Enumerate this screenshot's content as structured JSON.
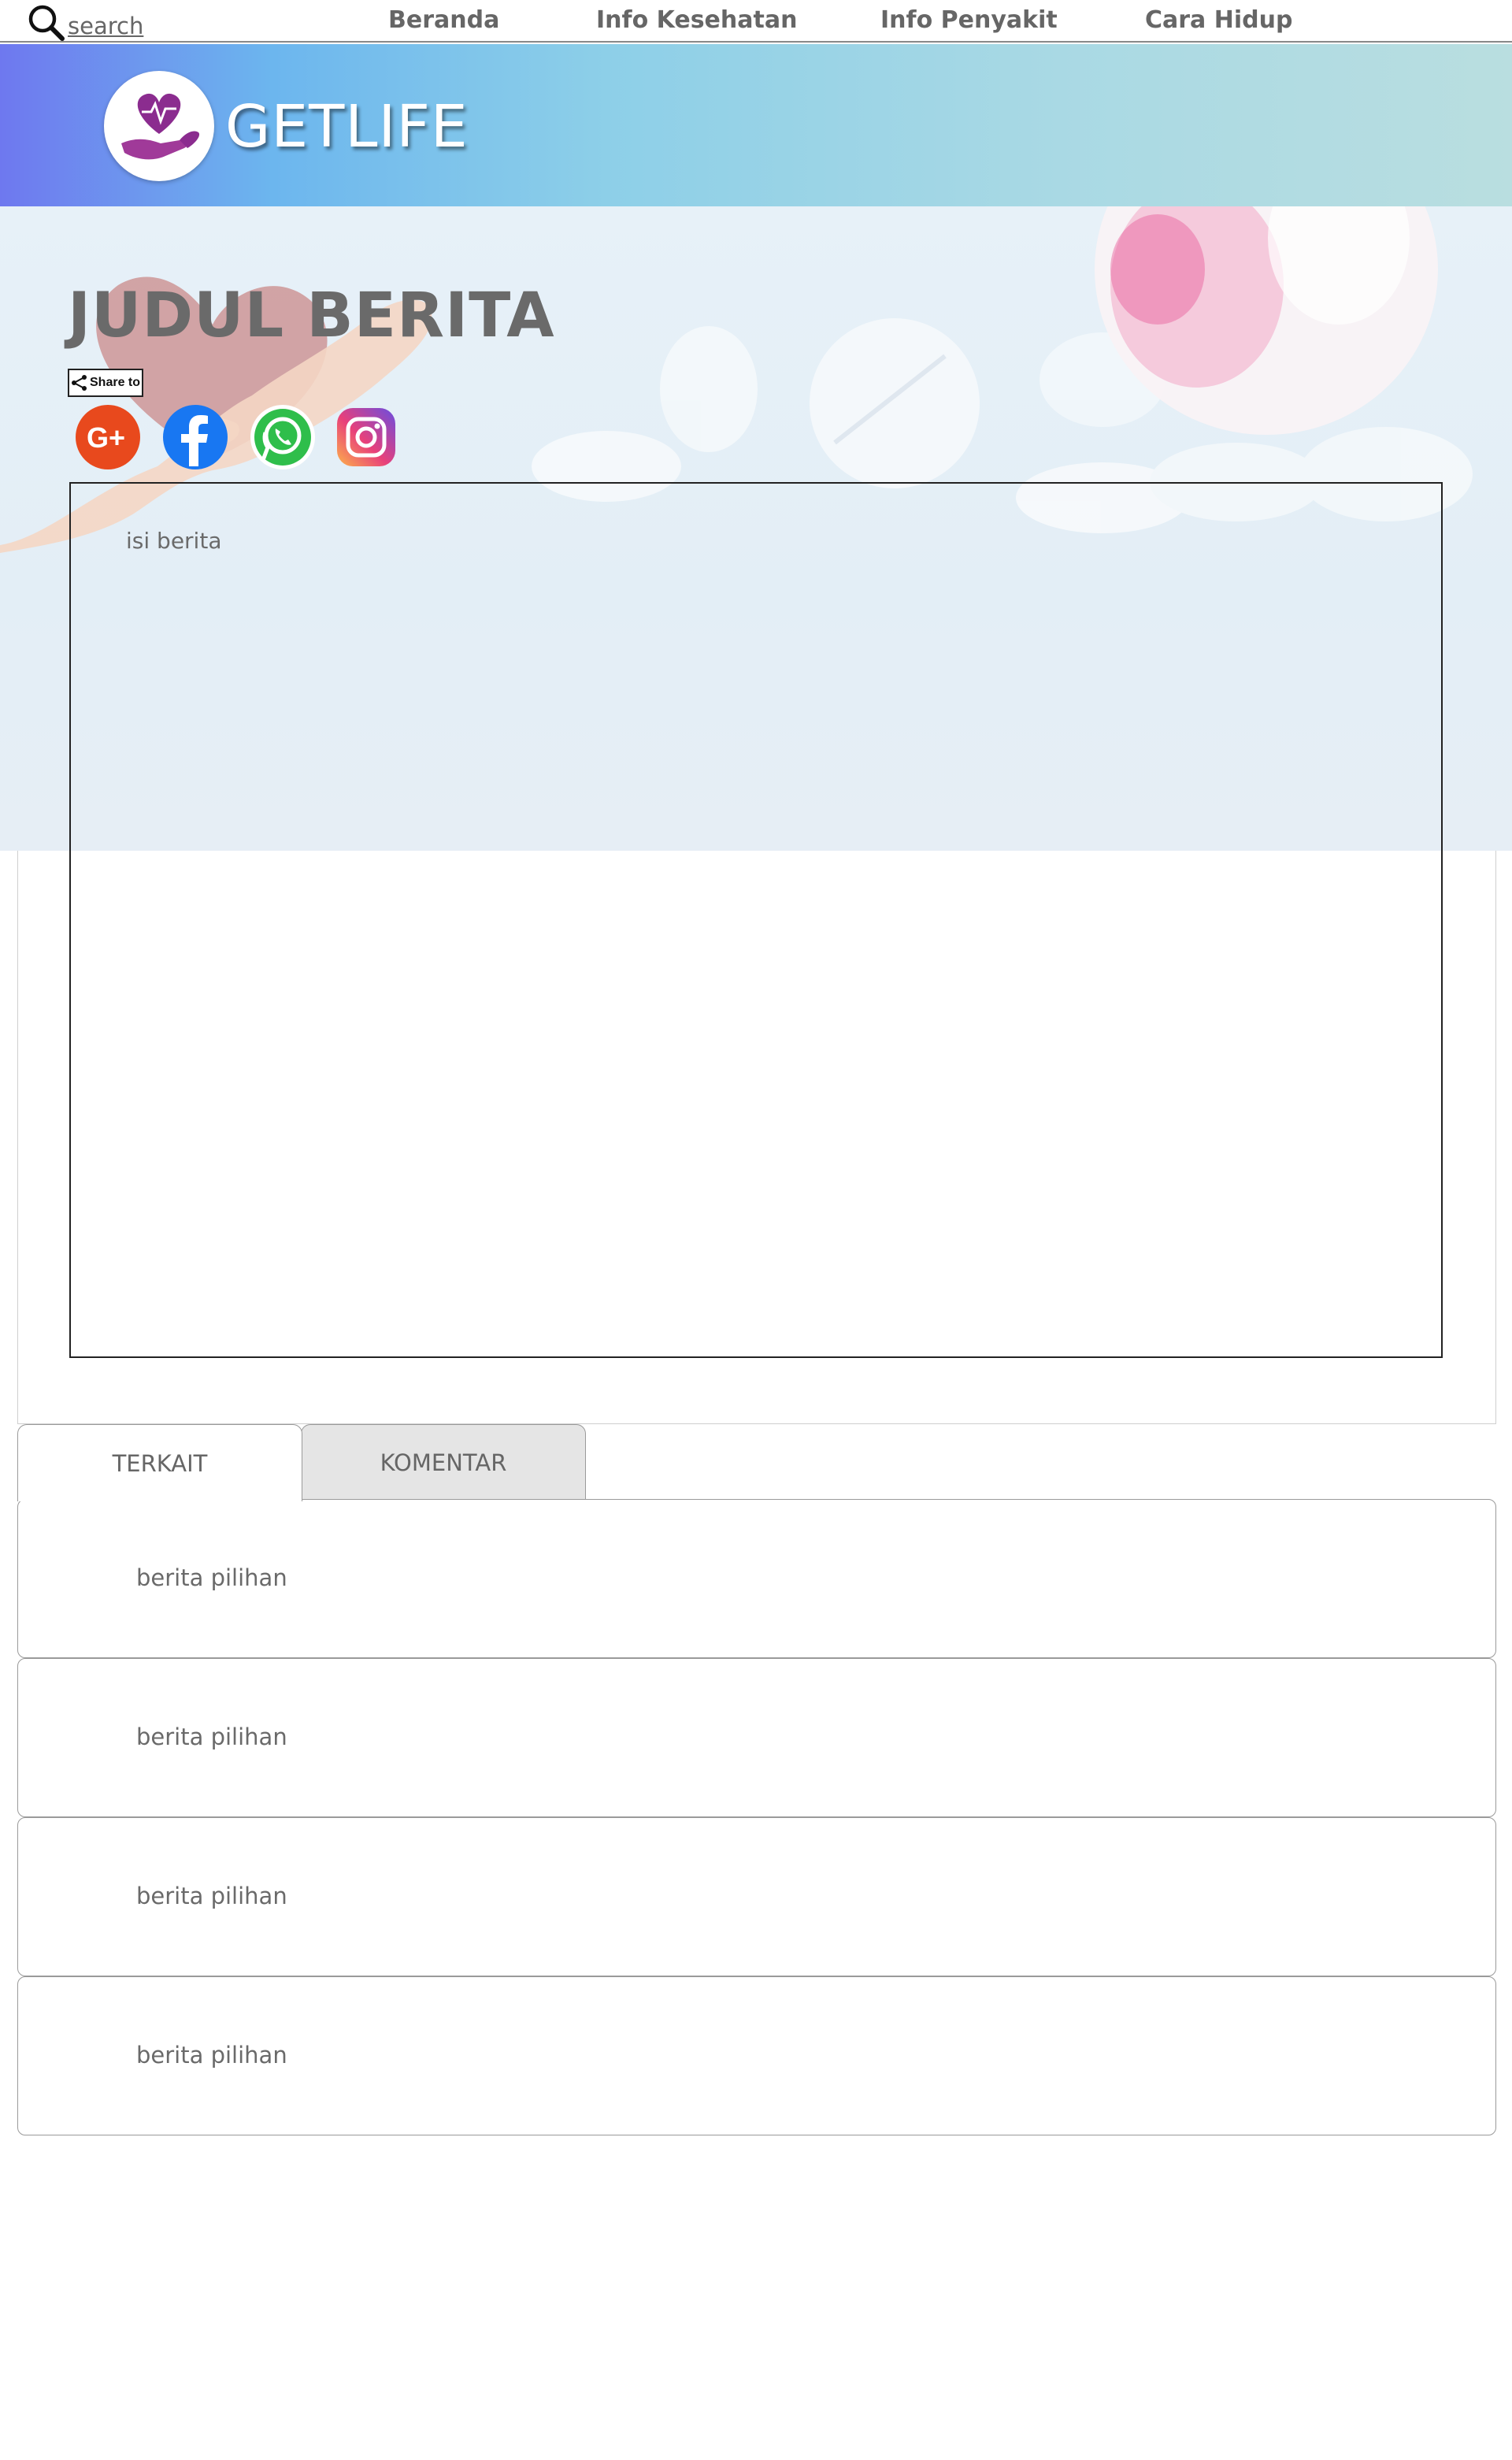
{
  "nav": {
    "search_label": "search",
    "items": [
      "Beranda",
      "Info Kesehatan",
      "Info Penyakit",
      "Cara Hidup"
    ]
  },
  "banner": {
    "brand": "GETLIFE",
    "logo_icon": "heart-hand-icon"
  },
  "article": {
    "title": "JUDUL BERITA",
    "share_label": "Share to",
    "social": [
      "google-plus-icon",
      "facebook-icon",
      "whatsapp-icon",
      "instagram-icon"
    ],
    "content": "isi berita"
  },
  "tabs": [
    {
      "label": "TERKAIT",
      "active": true
    },
    {
      "label": "KOMENTAR",
      "active": false
    }
  ],
  "related": [
    "berita pilihan",
    "berita pilihan",
    "berita pilihan",
    "berita pilihan"
  ],
  "colors": {
    "banner_start": "#6e78ef",
    "banner_end": "#b9dee0",
    "logo_purple": "#8b2c8f",
    "text_gray": "#6a6a6a"
  }
}
